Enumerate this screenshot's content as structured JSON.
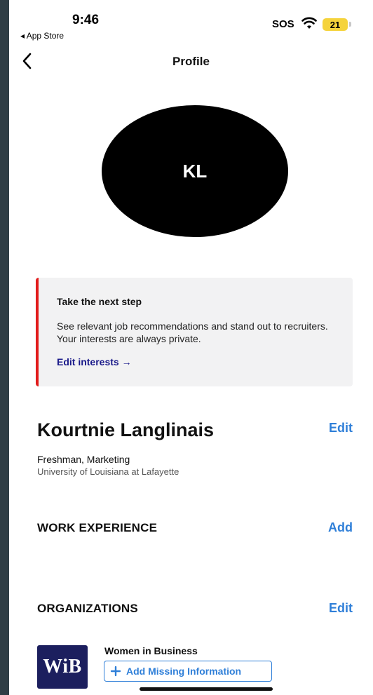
{
  "status_bar": {
    "time": "9:46",
    "back_app": "◂ App Store",
    "sos": "SOS",
    "battery": "21"
  },
  "nav": {
    "title": "Profile"
  },
  "avatar": {
    "initials": "KL"
  },
  "callout": {
    "title": "Take the next step",
    "body": "See relevant job recommendations and stand out to recruiters. Your interests are always private.",
    "link": "Edit interests →",
    "accent_color": "#e21b1b"
  },
  "profile": {
    "name": "Kourtnie Langlinais",
    "edit_label": "Edit",
    "class_major": "Freshman, Marketing",
    "school": "University of Louisiana at Lafayette"
  },
  "work_experience": {
    "heading": "WORK EXPERIENCE",
    "action": "Add"
  },
  "organizations": {
    "heading": "ORGANIZATIONS",
    "action": "Edit",
    "items": [
      {
        "logo_text": "WiB",
        "name": "Women in Business",
        "button": "Add Missing Information"
      }
    ]
  },
  "colors": {
    "link_blue": "#2f7fd8",
    "logo_bg": "#1c1f5e"
  }
}
